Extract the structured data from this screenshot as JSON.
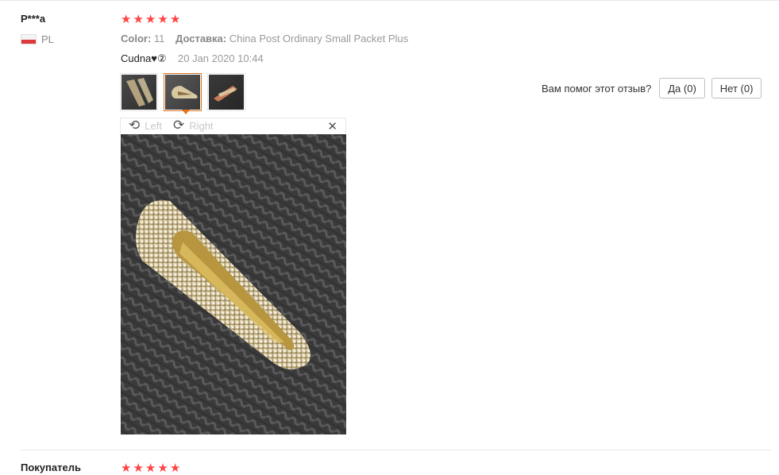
{
  "review": {
    "user_name": "P***a",
    "country": "PL",
    "rating": 5,
    "meta": {
      "color_label": "Color:",
      "color_value": "11",
      "shipping_label": "Доставка:",
      "shipping_value": "China Post Ordinary Small Packet Plus"
    },
    "text": "Cudna♥②",
    "date": "20 Jan 2020 10:44",
    "thumbnails": [
      "photo-1",
      "photo-2",
      "photo-3"
    ],
    "active_thumbnail": 2,
    "viewer": {
      "rotate_left_label": "Left",
      "rotate_right_label": "Right",
      "rotate_left_icon": "rotate-left-icon",
      "rotate_right_icon": "rotate-right-icon",
      "close_icon": "close-icon"
    },
    "helpful": {
      "question": "Вам помог этот отзыв?",
      "yes_label": "Да (0)",
      "no_label": "Нет (0)"
    }
  },
  "next_review": {
    "user_name": "Покупатель",
    "rating": 5
  },
  "colors": {
    "star": "#ff4444",
    "active_thumb_border": "#e0741f"
  }
}
